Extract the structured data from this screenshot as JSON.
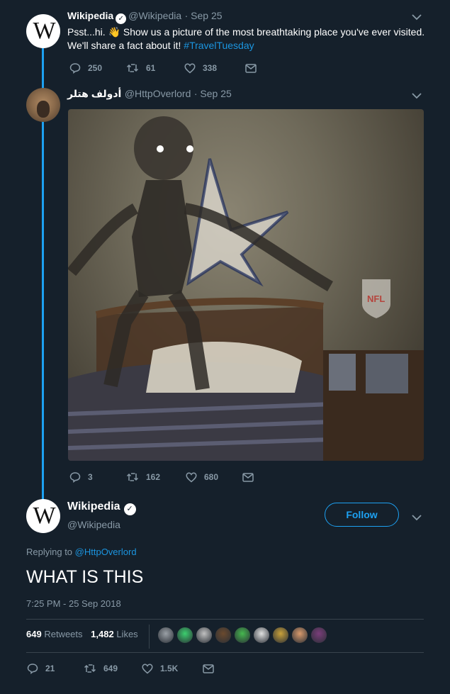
{
  "tweet1": {
    "name": "Wikipedia",
    "handle": "@Wikipedia",
    "date": "· Sep 25",
    "text": "Psst...hi. 👋 Show us a picture of the most breathtaking place you've ever visited.",
    "text2": "We'll share a fact about it! ",
    "hashtag": "#TravelTuesday",
    "replies": "250",
    "retweets": "61",
    "likes": "338"
  },
  "tweet2": {
    "name": "أدولف هتلر",
    "handle": "@HttpOverlord",
    "date": "· Sep 25",
    "replies": "3",
    "retweets": "162",
    "likes": "680",
    "photo_logo": "NFL"
  },
  "main": {
    "name": "Wikipedia",
    "handle": "@Wikipedia",
    "follow_label": "Follow",
    "replying_prefix": "Replying to ",
    "replying_to": "@HttpOverlord",
    "text": "WHAT IS THIS",
    "timestamp": "7:25 PM - 25 Sep 2018",
    "retweets_count": "649",
    "retweets_label": "Retweets",
    "likes_count": "1,482",
    "likes_label": "Likes",
    "replies": "21",
    "retweets": "649",
    "likes": "1.5K"
  },
  "avatar_letter": "W",
  "colors": {
    "background": "#15202b",
    "accent": "#1da1f2",
    "muted": "#8899a6"
  },
  "likers_avatars": [
    "#9aa0a6",
    "#3ccf6e",
    "#c0c0c0",
    "#6b4a2e",
    "#46b84f",
    "#e0e0e0",
    "#c9a13a",
    "#d99a6c",
    "#7a3d7a"
  ]
}
